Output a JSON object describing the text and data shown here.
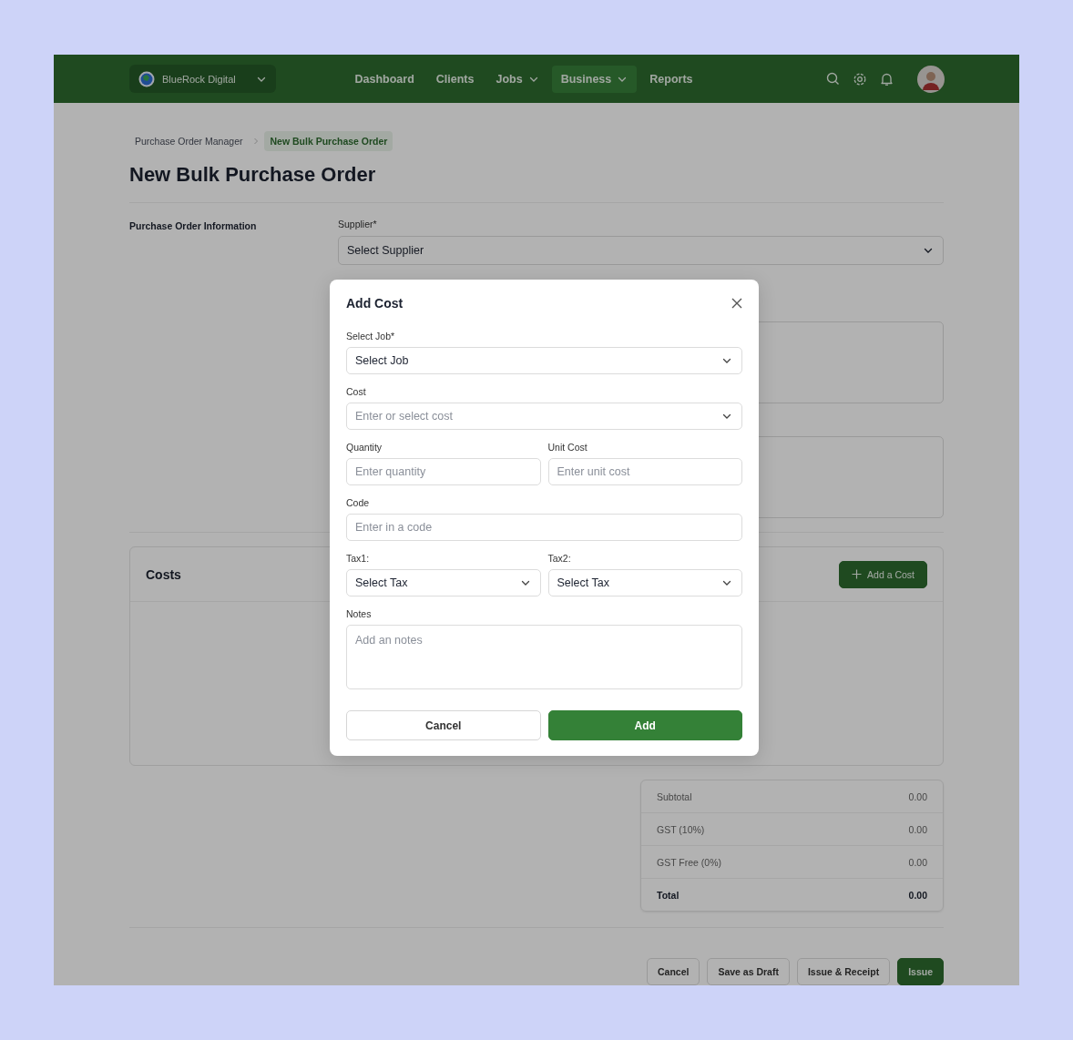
{
  "brand": {
    "name": "BlueRock Digital"
  },
  "nav": [
    {
      "label": "Dashboard",
      "selected": false,
      "has_menu": false
    },
    {
      "label": "Clients",
      "selected": false,
      "has_menu": false
    },
    {
      "label": "Jobs",
      "selected": false,
      "has_menu": true
    },
    {
      "label": "Business",
      "selected": true,
      "has_menu": true
    },
    {
      "label": "Reports",
      "selected": false,
      "has_menu": false
    }
  ],
  "breadcrumbs": [
    {
      "label": "Purchase Order Manager",
      "selected": false
    },
    {
      "label": "New Bulk Purchase Order",
      "selected": true
    }
  ],
  "title": "New Bulk Purchase Order",
  "info_section": {
    "label": "Purchase Order Information",
    "supplier": {
      "label": "Supplier*",
      "value": "Select Supplier"
    }
  },
  "costs": {
    "title": "Costs",
    "button": "Add a Cost"
  },
  "totals": [
    {
      "label": "Subtotal",
      "value": "0.00",
      "kind": "line"
    },
    {
      "label": "GST (10%)",
      "value": "0.00",
      "kind": "line"
    },
    {
      "label": "GST Free (0%)",
      "value": "0.00",
      "kind": "line"
    },
    {
      "label": "Total",
      "value": "0.00",
      "kind": "total"
    }
  ],
  "actions": [
    {
      "label": "Cancel",
      "kind": "secondary"
    },
    {
      "label": "Save as Draft",
      "kind": "secondary"
    },
    {
      "label": "Issue & Receipt",
      "kind": "secondary"
    },
    {
      "label": "Issue",
      "kind": "primary"
    }
  ],
  "modal": {
    "title": "Add Cost",
    "rows": [
      [
        {
          "label": "Select Job*",
          "kind": "select",
          "value": "Select Job"
        }
      ],
      [
        {
          "label": "Cost",
          "kind": "select",
          "placeholder": "Enter or select cost"
        }
      ],
      [
        {
          "label": "Quantity",
          "kind": "input",
          "placeholder": "Enter quantity"
        },
        {
          "label": "Unit Cost",
          "kind": "input",
          "placeholder": "Enter unit cost"
        }
      ],
      [
        {
          "label": "Code",
          "kind": "input",
          "placeholder": "Enter in a code"
        }
      ],
      [
        {
          "label": "Tax1:",
          "kind": "select",
          "value": "Select Tax"
        },
        {
          "label": "Tax2:",
          "kind": "select",
          "value": "Select Tax"
        }
      ],
      [
        {
          "label": "Notes",
          "kind": "textarea",
          "placeholder": "Add an notes"
        }
      ]
    ],
    "buttons": [
      {
        "label": "Cancel",
        "kind": "secondary"
      },
      {
        "label": "Add",
        "kind": "primary"
      }
    ]
  }
}
